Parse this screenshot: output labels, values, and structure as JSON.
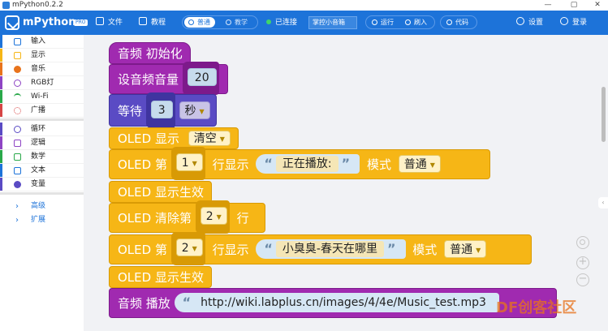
{
  "window": {
    "title": "mPython0.2.2",
    "controls": [
      "—",
      "▢",
      "✕"
    ]
  },
  "toolbar": {
    "app_name": "mPython",
    "app_badge": "PRO",
    "file_label": "文件",
    "tutorial_label": "教程",
    "mode_normal": "普通",
    "mode_teach": "教学",
    "connection_status": "已连接",
    "board_select": "掌控小音箱",
    "run_label": "运行",
    "flash_label": "刷入",
    "code_label": "代码",
    "settings_label": "设置",
    "login_label": "登录",
    "colors": {
      "primary": "#1d73d9",
      "connected": "#3fd66a"
    }
  },
  "sidebar": {
    "categories": [
      {
        "label": "输入",
        "color": "#1d73d9"
      },
      {
        "label": "显示",
        "color": "#f6b616"
      },
      {
        "label": "音乐",
        "color": "#e8731c"
      },
      {
        "label": "RGB灯",
        "color": "#8e44c4"
      },
      {
        "label": "Wi-Fi",
        "color": "#2aa84a"
      },
      {
        "label": "广播",
        "color": "#d64545"
      },
      {
        "label": "循环",
        "color": "#5a4bc4"
      },
      {
        "label": "逻辑",
        "color": "#8e44c4"
      },
      {
        "label": "数学",
        "color": "#2aa84a"
      },
      {
        "label": "文本",
        "color": "#1d73d9"
      },
      {
        "label": "变量",
        "color": "#5a4bc4"
      }
    ],
    "advanced_label": "高级",
    "extend_label": "扩展"
  },
  "blocks": {
    "b1": {
      "text": "音频 初始化"
    },
    "b2": {
      "text": "设音频音量",
      "value": "20"
    },
    "b3": {
      "text": "等待",
      "value": "3",
      "unit": "秒"
    },
    "b4": {
      "text": "OLED 显示",
      "option": "清空"
    },
    "b5": {
      "text": "OLED 第",
      "line": "1",
      "mid": "行显示",
      "string": "正在播放:",
      "mode_label": "模式",
      "mode": "普通"
    },
    "b6": {
      "text": "OLED 显示生效"
    },
    "b7": {
      "text": "OLED 清除第",
      "line": "2",
      "suffix": "行"
    },
    "b8": {
      "text": "OLED 第",
      "line": "2",
      "mid": "行显示",
      "string": "小臭臭-春天在哪里",
      "mode_label": "模式",
      "mode": "普通"
    },
    "b9": {
      "text": "OLED 显示生效"
    },
    "b10": {
      "text": "音频 播放",
      "url": "http://wiki.labplus.cn/images/4/4e/Music_test.mp3"
    }
  },
  "watermark": "DF创客社区"
}
